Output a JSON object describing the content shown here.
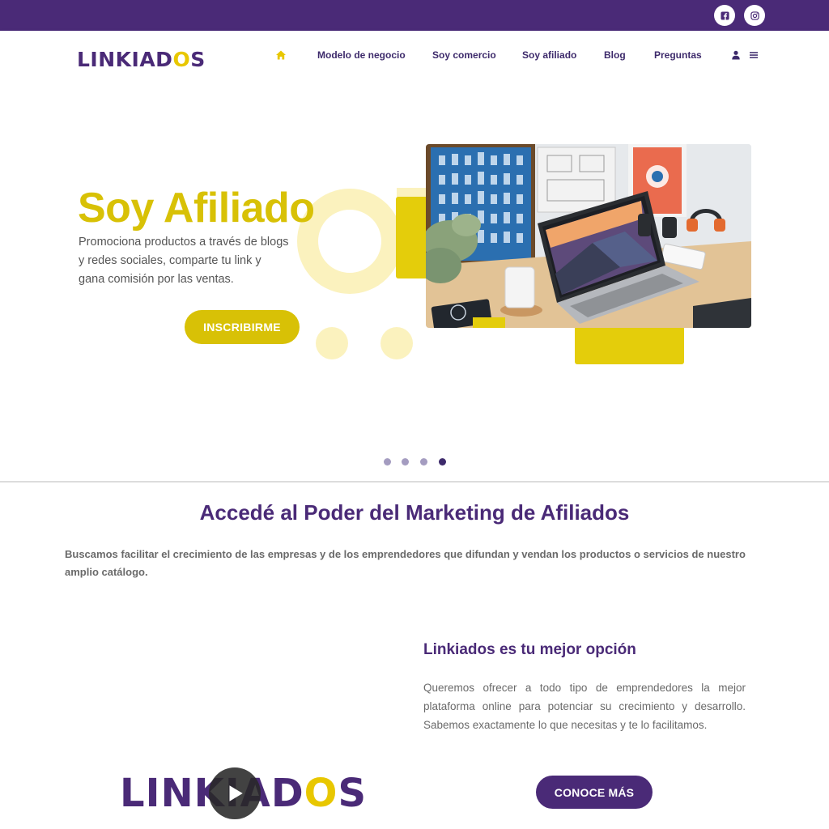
{
  "topbar": {
    "social": [
      {
        "name": "facebook-icon"
      },
      {
        "name": "instagram-icon"
      }
    ]
  },
  "brand": {
    "logo_prefix": "LINKIAD",
    "logo_o": "O",
    "logo_suffix": "S",
    "accent_color": "#d8c106",
    "primary_color": "#4a2a77"
  },
  "nav": {
    "home_icon": "home-icon",
    "items": [
      {
        "label": "Modelo de negocio"
      },
      {
        "label": "Soy comercio"
      },
      {
        "label": "Soy afiliado"
      },
      {
        "label": "Blog"
      },
      {
        "label": "Preguntas"
      }
    ],
    "user_icon": "user-icon",
    "menu_icon": "hamburger-menu-icon"
  },
  "hero": {
    "title": "Soy Afiliado",
    "text": "Promociona productos a través de blogs y redes sociales, comparte tu link y gana comisión por las ventas.",
    "button": "INSCRIBIRME",
    "slides_total": 4,
    "slide_active": 4
  },
  "section": {
    "title": "Accedé al Poder del Marketing de Afiliados",
    "text": "Buscamos facilitar el crecimiento de las empresas y de los emprendedores que difundan y vendan los productos o servicios de nuestro amplio catálogo.",
    "subtitle": "Linkiados es tu mejor opción",
    "subtext": "Queremos ofrecer a todo tipo de emprendedores la mejor plataforma online para potenciar su crecimiento y desarrollo. Sabemos exactamente lo que necesitas y te lo facilitamos.",
    "button": "CONOCE MÁS",
    "video_icon": "play-icon"
  }
}
